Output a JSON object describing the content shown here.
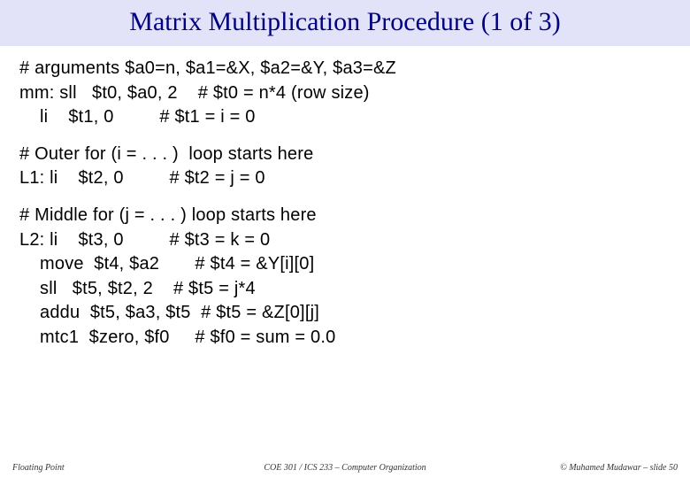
{
  "title": "Matrix Multiplication Procedure (1 of 3)",
  "code": {
    "b1l1": "# arguments $a0=n, $a1=&X, $a2=&Y, $a3=&Z",
    "b1l2": "mm: sll   $t0, $a0, 2    # $t0 = n*4 (row size)",
    "b1l3": "    li    $t1, 0         # $t1 = i = 0",
    "b2l1": "# Outer for (i = . . . )  loop starts here",
    "b2l2": "L1: li    $t2, 0         # $t2 = j = 0",
    "b3l1": "# Middle for (j = . . . ) loop starts here",
    "b3l2": "L2: li    $t3, 0         # $t3 = k = 0",
    "b3l3": "    move  $t4, $a2       # $t4 = &Y[i][0]",
    "b3l4": "    sll   $t5, $t2, 2    # $t5 = j*4",
    "b3l5": "    addu  $t5, $a3, $t5  # $t5 = &Z[0][j]",
    "b3l6": "    mtc1  $zero, $f0     # $f0 = sum = 0.0"
  },
  "footer": {
    "left": "Floating Point",
    "center": "COE 301 / ICS 233 – Computer Organization",
    "right": "© Muhamed Mudawar – slide 50"
  }
}
